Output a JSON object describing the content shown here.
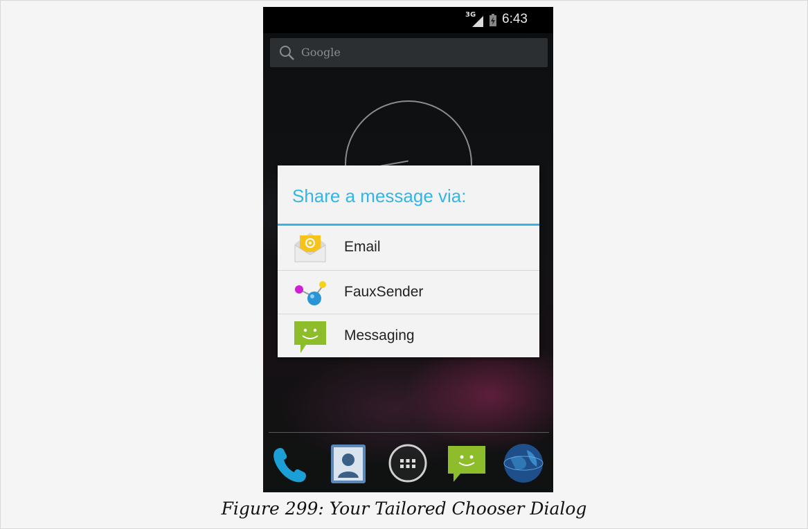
{
  "status_bar": {
    "network": "3G",
    "time": "6:43"
  },
  "search": {
    "placeholder": "Google"
  },
  "dialog": {
    "title": "Share a message via:",
    "options": [
      {
        "label": "Email",
        "icon": "email-icon"
      },
      {
        "label": "FauxSender",
        "icon": "fauxsender-icon"
      },
      {
        "label": "Messaging",
        "icon": "messaging-icon"
      }
    ]
  },
  "dock": {
    "icons": [
      "phone-icon",
      "contacts-icon",
      "app-launcher-icon",
      "messaging-icon",
      "browser-icon"
    ]
  },
  "caption": "Figure 299: Your Tailored Chooser Dialog",
  "colors": {
    "accent": "#33b5e5",
    "dialog_bg": "#f3f3f3",
    "page_bg": "#f5f5f5"
  }
}
